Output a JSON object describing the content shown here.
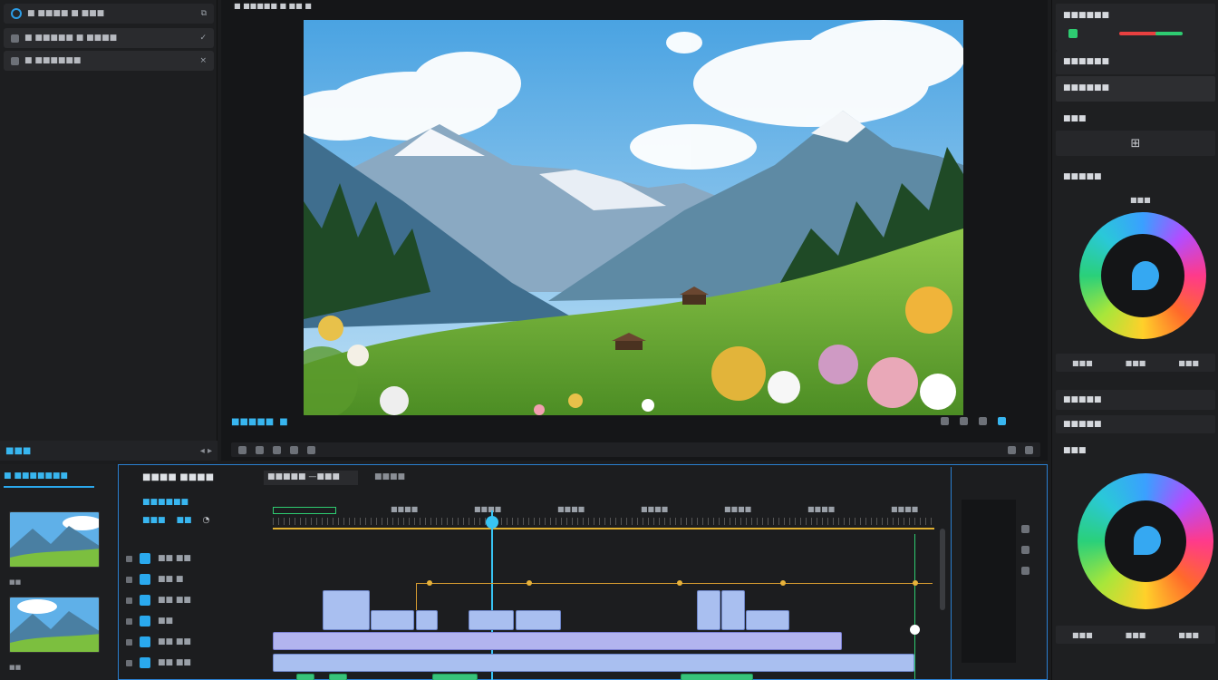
{
  "app": {
    "title": "■ ■■■■■ ■ ■■ ■",
    "accent": "#2aa9ee"
  },
  "left_panel": {
    "header": "■ ■■■■ ■ ■■■",
    "rows": [
      {
        "label": "■ ■■■■■ ■ ■■■■",
        "chev": "✓"
      },
      {
        "label": "■ ■■■■■■",
        "chev": "×"
      }
    ]
  },
  "preview": {
    "status_label": "■■■■■",
    "status_suffix": "■"
  },
  "right_panel": {
    "sections": [
      {
        "title": "■■■■■■"
      },
      {
        "title": "■■■■■■"
      },
      {
        "title": "■■■■■■"
      },
      {
        "title": "■■■"
      },
      {
        "title": "■■■■■"
      },
      {
        "title": "■■■■■"
      },
      {
        "title": "■■■■■"
      },
      {
        "title": "■■■"
      }
    ],
    "wheel1_label": "■■■",
    "wheel1_tabs": [
      "■■■",
      "■■■",
      "■■■"
    ],
    "wheel2_tabs": [
      "■■■",
      "■■■",
      "■■■"
    ],
    "button_icon": "⊞",
    "level_colors": [
      "#2ecc71",
      "#e84040"
    ]
  },
  "bin": {
    "tab": "■■■",
    "header": "■ ■■■■■■■",
    "item_labels": [
      "■■",
      "■■"
    ]
  },
  "timeline": {
    "title": "■■■■ ■■■■",
    "sequence_tab": "■■■■■ —■■■",
    "extra_tab": "■■■■",
    "subtitle": "■■■■■■",
    "controls": [
      "■■■",
      "■■"
    ],
    "ruler_labels": [
      "■■■■",
      "■■■■",
      "■■■■",
      "■■■■",
      "■■■■",
      "■■■■",
      "■■■■",
      "■■■■"
    ],
    "tracks": [
      {
        "name": "■■ ■■"
      },
      {
        "name": "■■ ■"
      },
      {
        "name": "■■ ■■"
      },
      {
        "name": "■■"
      },
      {
        "name": "■■ ■■"
      },
      {
        "name": "■■ ■■"
      }
    ],
    "playhead_percent": 33
  }
}
